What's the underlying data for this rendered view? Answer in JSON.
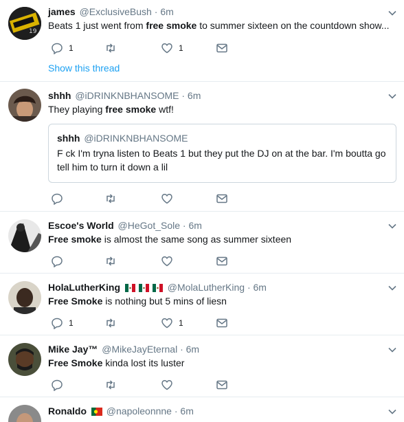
{
  "tweets": [
    {
      "name": "james",
      "handle": "@ExclusiveBush",
      "dot": "·",
      "time": "6m",
      "text_pre": "Beats 1 just went from ",
      "text_bold": "free smoke",
      "text_post": " to summer sixteen on the countdown show...",
      "reply_count": "1",
      "retweet_count": "",
      "like_count": "1",
      "thread_link": "Show this thread"
    },
    {
      "name": "shhh",
      "handle": "@iDRINKNBHANSOME",
      "dot": "·",
      "time": "6m",
      "text_pre": "They playing ",
      "text_bold": "free smoke",
      "text_post": " wtf!",
      "quote": {
        "name": "shhh",
        "handle": "@iDRINKNBHANSOME",
        "text": "F  ck I'm tryna listen to Beats 1 but they put the DJ on at the bar. I'm boutta go tell him to turn it down a lil"
      },
      "reply_count": "",
      "retweet_count": "",
      "like_count": ""
    },
    {
      "name": "Escoe's World",
      "handle": "@HeGot_Sole",
      "dot": "·",
      "time": "6m",
      "text_pre": "",
      "text_bold": "Free smoke",
      "text_post": " is almost the same song as summer sixteen",
      "reply_count": "",
      "retweet_count": "",
      "like_count": ""
    },
    {
      "name": "HolaLutherKing",
      "handle": "@MolaLutherKing",
      "dot": "·",
      "time": "6m",
      "text_pre": "",
      "text_bold": "Free Smoke",
      "text_post": " is nothing but 5 mins of liesn",
      "reply_count": "1",
      "retweet_count": "",
      "like_count": "1"
    },
    {
      "name": "Mike Jay™",
      "handle": "@MikeJayEternal",
      "dot": "·",
      "time": "6m",
      "text_pre": "",
      "text_bold": "Free Smoke",
      "text_post": " kinda lost its luster",
      "reply_count": "",
      "retweet_count": "",
      "like_count": ""
    },
    {
      "name": "Ronaldo",
      "handle": "@napoleonnne",
      "dot": "·",
      "time": "6m"
    }
  ],
  "icons": {
    "reply": "reply-icon",
    "retweet": "retweet-icon",
    "like": "heart-icon",
    "dm": "envelope-icon",
    "more": "chevron-down-icon",
    "flag_mexico": "mexico-flag-icon",
    "flag_portugal": "portugal-flag-icon"
  },
  "colors": {
    "link": "#1da1f2",
    "muted": "#657786",
    "text": "#14171a",
    "border": "#e6ecf0"
  }
}
